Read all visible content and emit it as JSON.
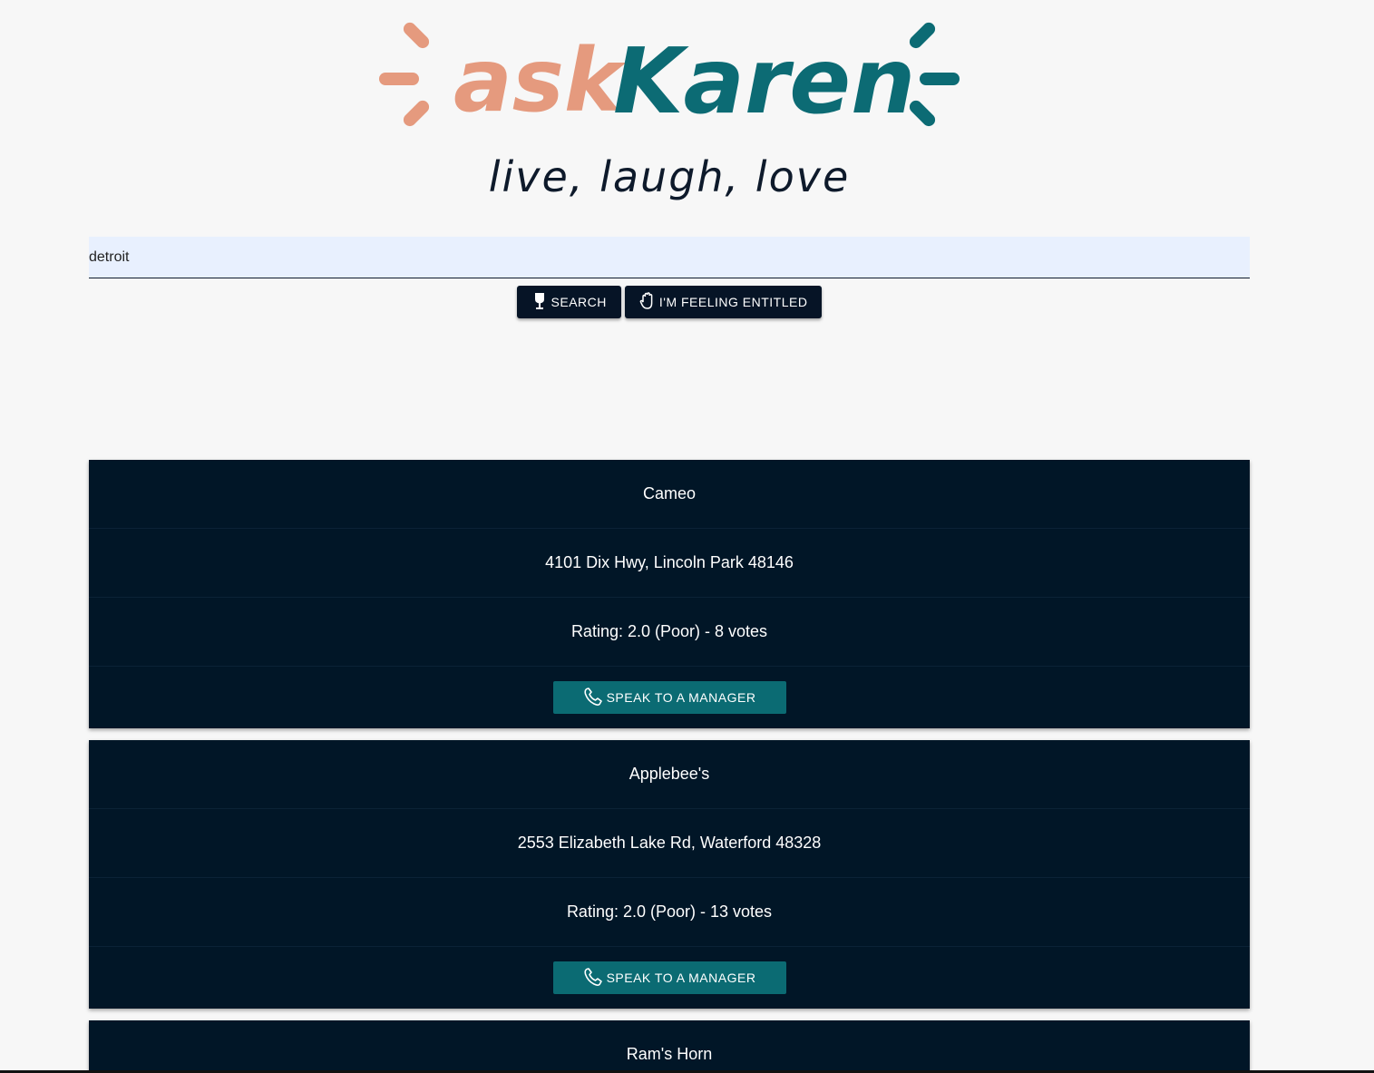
{
  "logo": {
    "ask": "ask",
    "karen": "Karen",
    "tagline": "live, laugh, love",
    "colors": {
      "ask": "#e59a7e",
      "karen": "#0c6b74"
    }
  },
  "search": {
    "value": "detroit",
    "search_label": "SEARCH",
    "search_icon": "wine-glass-icon",
    "entitled_label": "I'M FEELING ENTITLED",
    "entitled_icon": "hand-icon"
  },
  "results": [
    {
      "name": "Cameo",
      "address": "4101 Dix Hwy, Lincoln Park 48146",
      "rating": "Rating: 2.0 (Poor) - 8 votes",
      "action_label": "SPEAK TO A MANAGER",
      "action_icon": "phone-icon"
    },
    {
      "name": "Applebee's",
      "address": "2553 Elizabeth Lake Rd, Waterford 48328",
      "rating": "Rating: 2.0 (Poor) - 13 votes",
      "action_label": "SPEAK TO A MANAGER",
      "action_icon": "phone-icon"
    },
    {
      "name": "Ram's Horn"
    }
  ],
  "colors": {
    "card_bg": "#011627",
    "button_dark": "#061426",
    "button_teal": "#0b6b73",
    "input_bg": "#e8f0fe"
  }
}
